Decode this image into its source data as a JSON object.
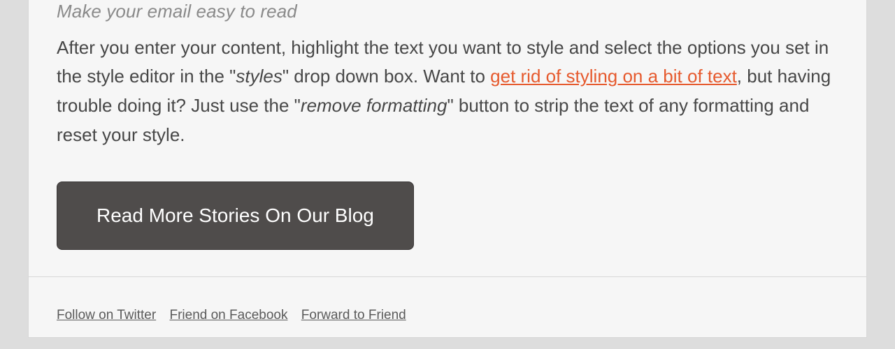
{
  "content": {
    "lead": "Make your email easy to read",
    "body": {
      "seg1": "After you enter your content, highlight the text you want to style and select the options you set in the style editor in the \"",
      "italic1": "styles",
      "seg2": "\" drop down box. Want to ",
      "link_text": "get rid of styling on a bit of text",
      "seg3": ", but having trouble doing it? Just use the \"",
      "italic2": "remove formatting",
      "seg4": "\" button to strip the text of any formatting and reset your style."
    },
    "cta_label": "Read More Stories On Our Blog"
  },
  "footer": {
    "links": {
      "twitter": "Follow on Twitter",
      "facebook": "Friend on Facebook",
      "forward": "Forward to Friend"
    }
  }
}
